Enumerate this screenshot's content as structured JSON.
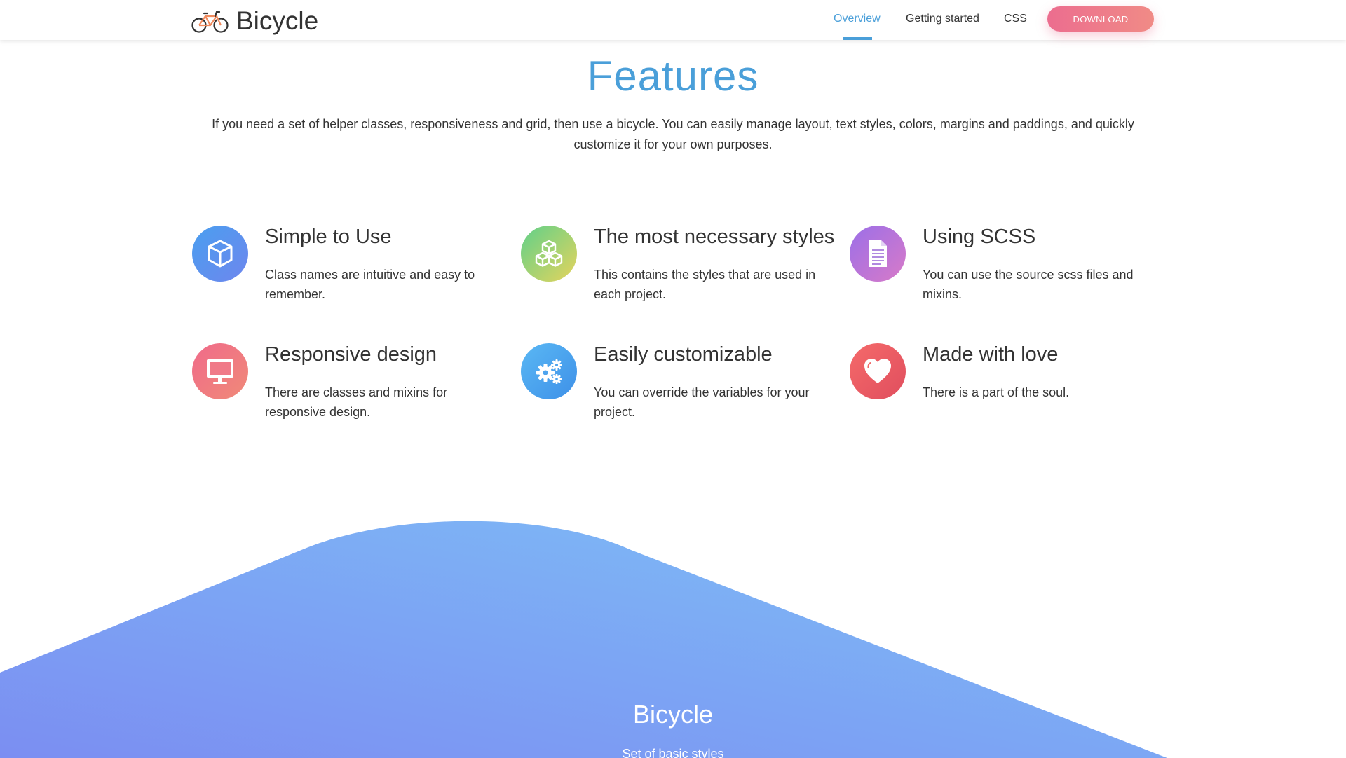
{
  "header": {
    "brand_name": "Bicycle",
    "nav": [
      {
        "label": "Overview",
        "active": true
      },
      {
        "label": "Getting started",
        "active": false
      },
      {
        "label": "CSS",
        "active": false
      }
    ],
    "download_label": "DOWNLOAD"
  },
  "features": {
    "title": "Features",
    "intro": "If you need a set of helper classes, responsiveness and grid, then use a bicycle. You can easily manage layout, text styles, colors, margins and paddings, and quickly customize it for your own purposes.",
    "items": [
      {
        "title": "Simple to Use",
        "text": "Class names are intuitive and easy to remember.",
        "icon": "cube-icon",
        "color_from": "#4a9fef",
        "color_to": "#6e86ee"
      },
      {
        "title": "The most necessary styles",
        "text": "This contains the styles that are used in each project.",
        "icon": "cubes-icon",
        "color_from": "#5fd08a",
        "color_to": "#e6d45c"
      },
      {
        "title": "Using SCSS",
        "text": "You can use the source scss files and mixins.",
        "icon": "document-icon",
        "color_from": "#9b6fe8",
        "color_to": "#d87ac8"
      },
      {
        "title": "Responsive design",
        "text": "There are classes and mixins for responsive design.",
        "icon": "monitor-icon",
        "color_from": "#f06a8a",
        "color_to": "#f08a78"
      },
      {
        "title": "Easily customizable",
        "text": "You can override the variables for your project.",
        "icon": "gears-icon",
        "color_from": "#5ab8f4",
        "color_to": "#3e90e8"
      },
      {
        "title": "Made with love",
        "text": "There is a part of the soul.",
        "icon": "heart-icon",
        "color_from": "#f56a6a",
        "color_to": "#e04e5e"
      }
    ]
  },
  "hero": {
    "title": "Bicycle",
    "subtitle": "Set of basic styles",
    "color_from": "#7b8ef2",
    "color_to": "#7ec0f6"
  }
}
